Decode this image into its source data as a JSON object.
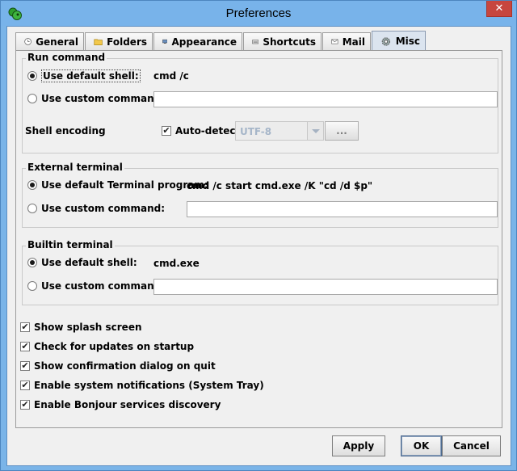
{
  "window": {
    "title": "Preferences",
    "close_glyph": "✕"
  },
  "tabs": [
    {
      "label": "General",
      "icon": "clock-icon"
    },
    {
      "label": "Folders",
      "icon": "folder-icon"
    },
    {
      "label": "Appearance",
      "icon": "monitor-icon"
    },
    {
      "label": "Shortcuts",
      "icon": "keyboard-icon"
    },
    {
      "label": "Mail",
      "icon": "envelope-icon"
    },
    {
      "label": "Misc",
      "icon": "gear-icon",
      "active": true
    }
  ],
  "run_command": {
    "title": "Run command",
    "default_label": "Use default shell:",
    "default_value": "cmd /c",
    "custom_label": "Use custom command:",
    "custom_value": "",
    "encoding_label": "Shell encoding",
    "autodetect_label": "Auto-detect",
    "encoding_value": "UTF-8",
    "browse_label": "..."
  },
  "external_terminal": {
    "title": "External terminal",
    "default_label": "Use default Terminal program:",
    "default_value": "cmd /c start cmd.exe /K \"cd /d $p\"",
    "custom_label": "Use custom command:",
    "custom_value": ""
  },
  "builtin_terminal": {
    "title": "Builtin terminal",
    "default_label": "Use default shell:",
    "default_value": "cmd.exe",
    "custom_label": "Use custom command:",
    "custom_value": ""
  },
  "options": [
    {
      "label": "Show splash screen",
      "checked": true
    },
    {
      "label": "Check for updates on startup",
      "checked": true
    },
    {
      "label": "Show confirmation dialog on quit",
      "checked": true
    },
    {
      "label": "Enable system notifications (System Tray)",
      "checked": true
    },
    {
      "label": "Enable Bonjour services discovery",
      "checked": true
    }
  ],
  "buttons": {
    "apply": "Apply",
    "ok": "OK",
    "cancel": "Cancel"
  },
  "check_glyph": "✔"
}
